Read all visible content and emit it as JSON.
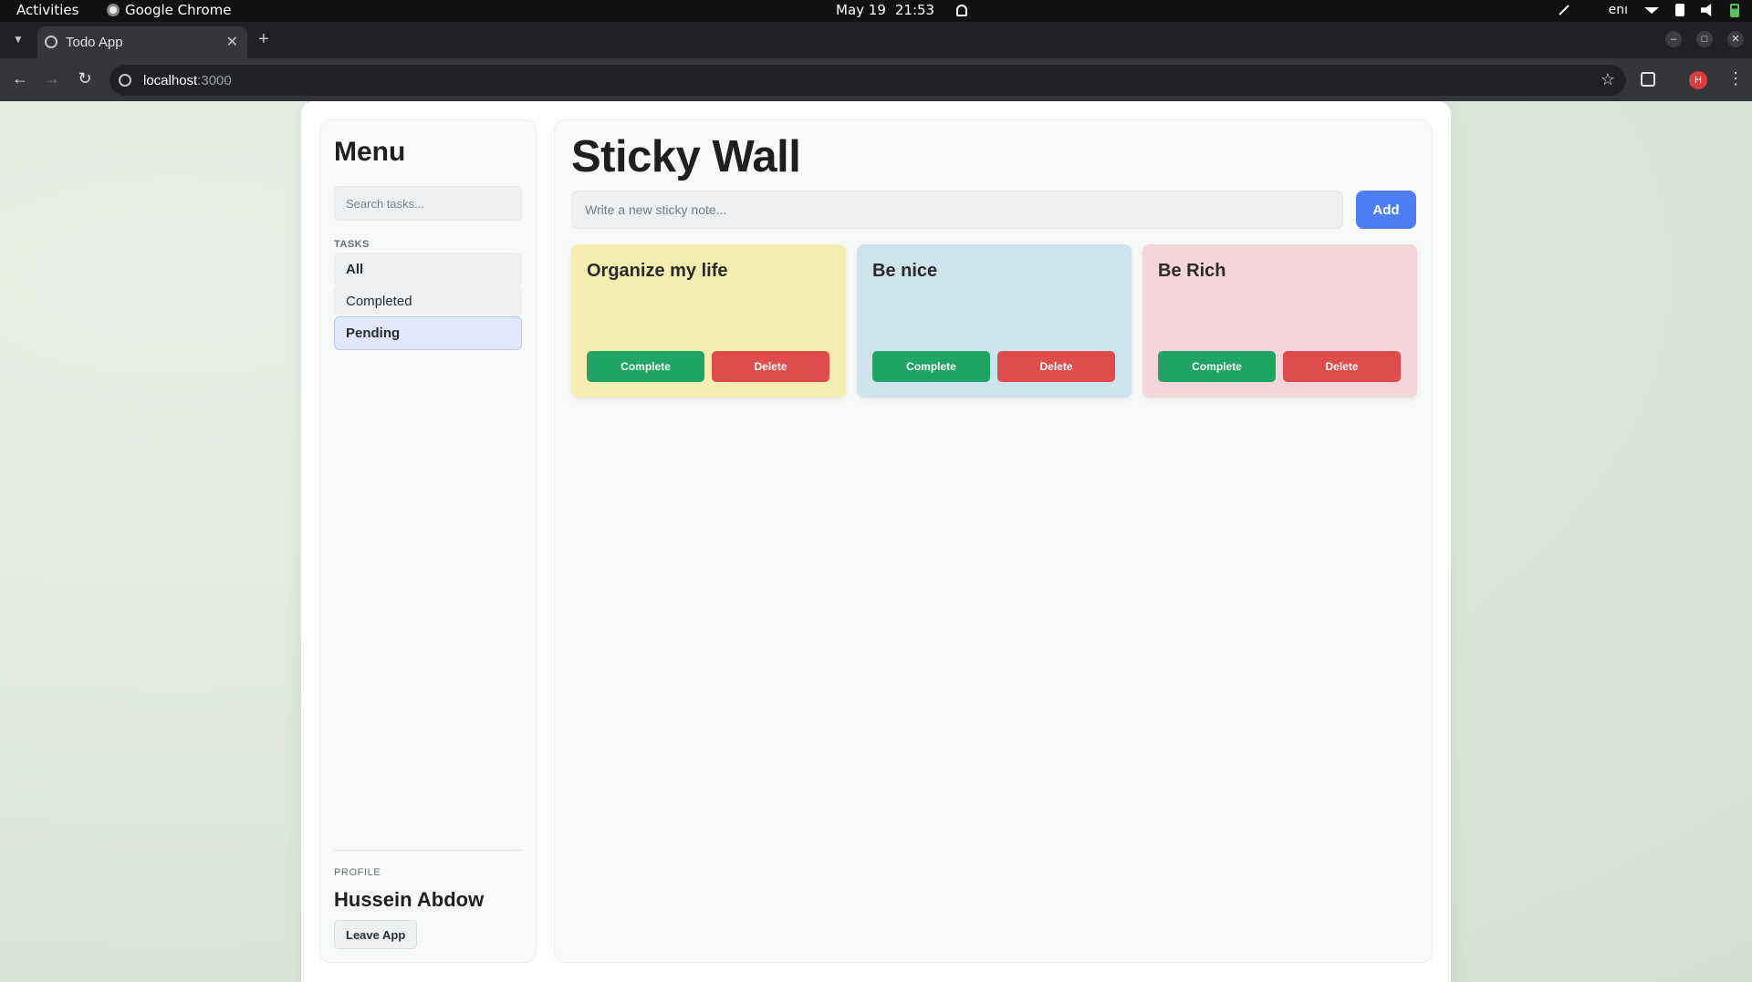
{
  "os_bar": {
    "activities": "Activities",
    "app_name": "Google Chrome",
    "date": "May 19",
    "time": "21:53",
    "lang": "enı"
  },
  "browser": {
    "tab_title": "Todo App",
    "url_host": "localhost",
    "url_port": ":3000",
    "profile_initial": "H"
  },
  "sidebar": {
    "title": "Menu",
    "search_placeholder": "Search tasks...",
    "tasks_label": "TASKS",
    "filters": [
      {
        "label": "All",
        "active": false
      },
      {
        "label": "Completed",
        "active": false
      },
      {
        "label": "Pending",
        "active": true
      }
    ],
    "profile_label": "PROFILE",
    "profile_name": "Hussein Abdow",
    "leave_label": "Leave App"
  },
  "main": {
    "title": "Sticky Wall",
    "note_placeholder": "Write a new sticky note...",
    "add_label": "Add",
    "notes": [
      {
        "title": "Organize my life",
        "color": "#f6eeb0",
        "complete_label": "Complete",
        "delete_label": "Delete"
      },
      {
        "title": "Be nice",
        "color": "#cde4ec",
        "complete_label": "Complete",
        "delete_label": "Delete"
      },
      {
        "title": "Be Rich",
        "color": "#f4d6da",
        "complete_label": "Complete",
        "delete_label": "Delete"
      }
    ]
  },
  "colors": {
    "accent": "#4f7cf7",
    "complete": "#20a464",
    "delete": "#df4c4c",
    "active_filter": "#e1e8fb"
  }
}
